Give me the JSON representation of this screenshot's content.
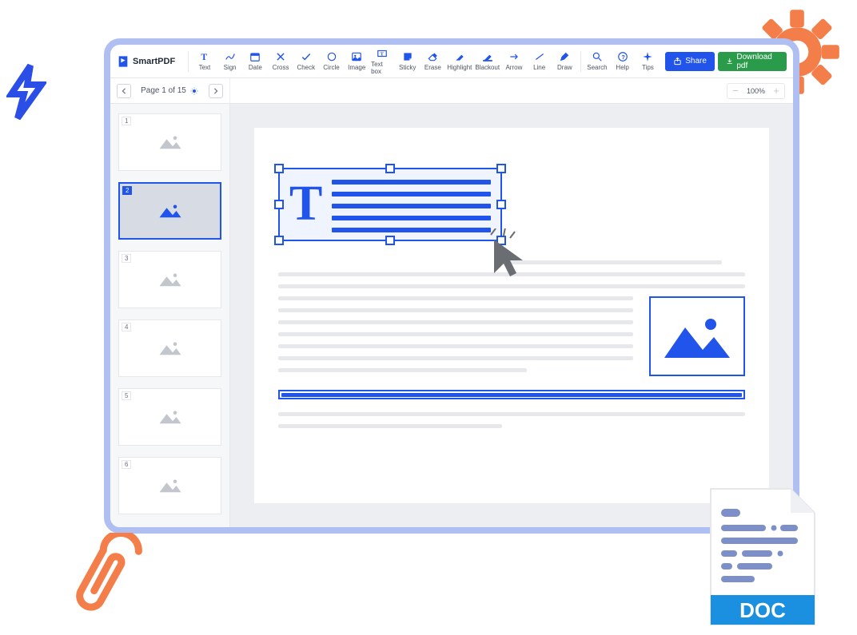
{
  "brand": "SmartPDF",
  "tools": {
    "text": "Text",
    "sign": "Sign",
    "date": "Date",
    "cross": "Cross",
    "check": "Check",
    "circle": "Circle",
    "image": "Image",
    "textbox": "Text box",
    "sticky": "Sticky",
    "erase": "Erase",
    "highlight": "Highlight",
    "blackout": "Blackout",
    "arrow": "Arrow",
    "line": "Line",
    "draw": "Draw",
    "search": "Search",
    "help": "Help",
    "tips": "Tips"
  },
  "buttons": {
    "share": "Share",
    "download": "Download pdf"
  },
  "pageInfo": "Page 1 of 15",
  "zoom": "100%",
  "thumbs": [
    "1",
    "2",
    "3",
    "4",
    "5",
    "6"
  ],
  "activeThumb": 2,
  "docLabel": "DOC"
}
